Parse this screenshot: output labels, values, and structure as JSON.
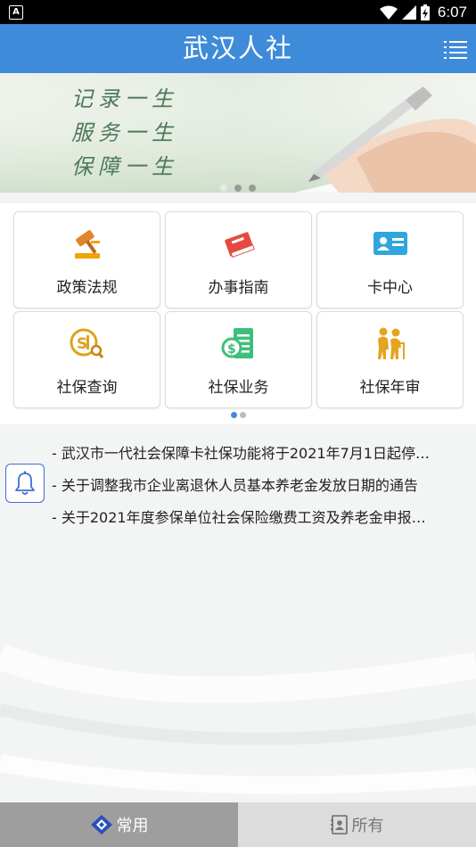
{
  "status_bar": {
    "app_badge": "A",
    "time": "6:07"
  },
  "header": {
    "title": "武汉人社"
  },
  "banner": {
    "slogans": [
      "记录一生",
      "服务一生",
      "保障一生"
    ],
    "page_count": 3,
    "active_page": 1
  },
  "grid": {
    "items": [
      {
        "label": "政策法规",
        "icon": "gavel-icon",
        "color": "#f0a400"
      },
      {
        "label": "办事指南",
        "icon": "book-icon",
        "color": "#e64a3f"
      },
      {
        "label": "卡中心",
        "icon": "id-card-icon",
        "color": "#2fa6dd"
      },
      {
        "label": "社保查询",
        "icon": "ss-search-icon",
        "color": "#e0a21a"
      },
      {
        "label": "社保业务",
        "icon": "ss-document-icon",
        "color": "#3dbf7a"
      },
      {
        "label": "社保年审",
        "icon": "elderly-couple-icon",
        "color": "#e5a41d"
      }
    ],
    "page_count": 2,
    "active_page": 1
  },
  "notices": {
    "items": [
      "- 武汉市一代社会保障卡社保功能将于2021年7月1日起停…",
      "- 关于调整我市企业离退休人员基本养老金发放日期的通告",
      "- 关于2021年度参保单位社会保险缴费工资及养老金申报…"
    ]
  },
  "tabbar": {
    "tabs": [
      {
        "label": "常用",
        "icon": "diamond-icon",
        "active": true
      },
      {
        "label": "所有",
        "icon": "contact-book-icon",
        "active": false
      }
    ]
  },
  "colors": {
    "primary": "#3e8bd9",
    "tab_active": "#9e9e9e",
    "tab_inactive": "#dcdcdc"
  }
}
